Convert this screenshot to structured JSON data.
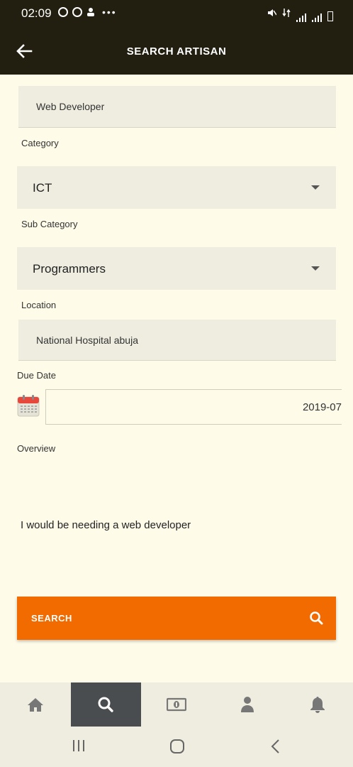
{
  "status_bar": {
    "time": "02:09"
  },
  "app_bar": {
    "title": "SEARCH ARTISAN",
    "back_icon": "arrow-left-icon"
  },
  "form": {
    "job_title_value": "Web Developer",
    "category_label": "Category",
    "category_value": "ICT",
    "sub_category_label": "Sub Category",
    "sub_category_value": "Programmers",
    "location_label": "Location",
    "location_value": "National Hospital abuja",
    "due_date_label": "Due Date",
    "due_date_value": "2019-07",
    "overview_label": "Overview",
    "overview_value": "I would be needing a web developer"
  },
  "search_button": {
    "label": "SEARCH",
    "icon": "search-icon"
  },
  "bottom_nav": {
    "items": [
      {
        "name": "home",
        "icon": "home-icon"
      },
      {
        "name": "search",
        "icon": "search-icon",
        "active": true
      },
      {
        "name": "payment",
        "icon": "money-icon"
      },
      {
        "name": "profile",
        "icon": "person-icon"
      },
      {
        "name": "notifications",
        "icon": "bell-icon"
      }
    ]
  },
  "colors": {
    "header_bg": "#231f10",
    "page_bg": "#fefce9",
    "field_bg": "#efede0",
    "accent": "#f26b00",
    "nav_active": "#4a4d4f"
  }
}
